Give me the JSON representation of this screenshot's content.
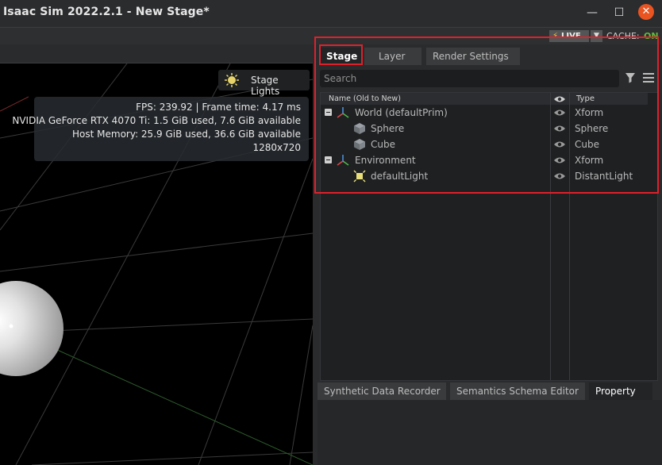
{
  "window": {
    "title": "Isaac Sim 2022.2.1 - New Stage*",
    "minimize": "—",
    "maximize": "☐",
    "close": "✕"
  },
  "statusbar": {
    "live_label": "LIVE",
    "cache_label": "CACHE:",
    "cache_value": "ON",
    "cache_color": "#5fbf3b"
  },
  "viewport": {
    "stage_lights_label": "Stage Lights",
    "stats": [
      "FPS: 239.92 | Frame time: 4.17 ms",
      "NVIDIA GeForce RTX 4070 Ti: 1.5 GiB used, 7.6 GiB available",
      "Host Memory: 25.9 GiB used, 36.6 GiB available",
      "1280x720"
    ]
  },
  "stage_panel": {
    "tabs": [
      "Stage",
      "Layer",
      "Render Settings"
    ],
    "active_tab": "Stage",
    "search_placeholder": "Search",
    "columns": {
      "name": "Name (Old to New)",
      "type": "Type"
    },
    "rows": [
      {
        "label": "World (defaultPrim)",
        "type": "Xform",
        "icon": "xform-icon",
        "expandable": true
      },
      {
        "label": "Sphere",
        "type": "Sphere",
        "icon": "cube-mesh-icon",
        "expandable": false
      },
      {
        "label": "Cube",
        "type": "Cube",
        "icon": "cube-mesh-icon",
        "expandable": false
      },
      {
        "label": "Environment",
        "type": "Xform",
        "icon": "xform-icon",
        "expandable": true
      },
      {
        "label": "defaultLight",
        "type": "DistantLight",
        "icon": "light-icon",
        "expandable": false
      }
    ]
  },
  "bottom_panel": {
    "tabs": [
      "Synthetic Data Recorder",
      "Semantics Schema Editor",
      "Property"
    ],
    "active_tab": "Property"
  },
  "accent_colors": {
    "highlight_box": "#e0202a",
    "close_button": "#e95420"
  }
}
